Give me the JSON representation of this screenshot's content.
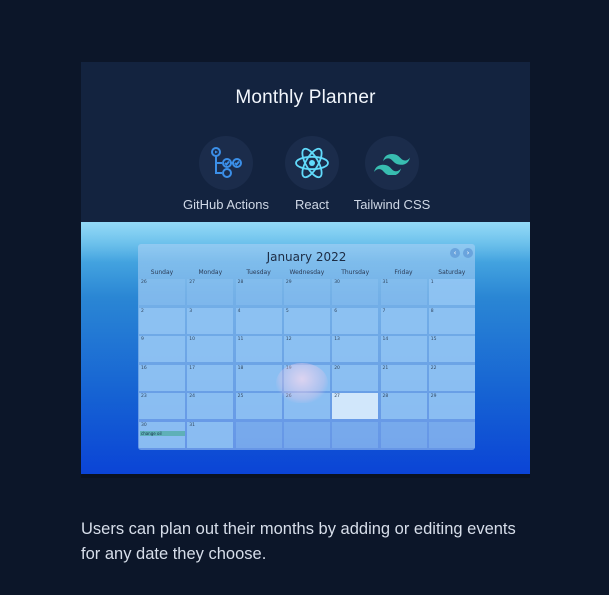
{
  "project": {
    "title": "Monthly Planner",
    "tech": [
      {
        "label": "GitHub Actions",
        "icon": "github-actions-icon"
      },
      {
        "label": "React",
        "icon": "react-icon"
      },
      {
        "label": "Tailwind CSS",
        "icon": "tailwind-icon"
      }
    ],
    "caption": "Users can plan out their months by adding or editing events for any date they choose."
  },
  "calendar": {
    "title": "January 2022",
    "prev_icon": "chevron-left-icon",
    "next_icon": "chevron-right-icon",
    "weekdays": [
      "Sunday",
      "Monday",
      "Tuesday",
      "Wednesday",
      "Thursday",
      "Friday",
      "Saturday"
    ],
    "weeks": [
      [
        "26",
        "27",
        "28",
        "29",
        "30",
        "31",
        "1"
      ],
      [
        "2",
        "3",
        "4",
        "5",
        "6",
        "7",
        "8"
      ],
      [
        "9",
        "10",
        "11",
        "12",
        "13",
        "14",
        "15"
      ],
      [
        "16",
        "17",
        "18",
        "19",
        "20",
        "21",
        "22"
      ],
      [
        "23",
        "24",
        "25",
        "26",
        "27",
        "28",
        "29"
      ],
      [
        "30",
        "31",
        "",
        "",
        "",
        "",
        ""
      ]
    ],
    "event": {
      "date": "30",
      "text": "change oil"
    },
    "today": "27"
  }
}
